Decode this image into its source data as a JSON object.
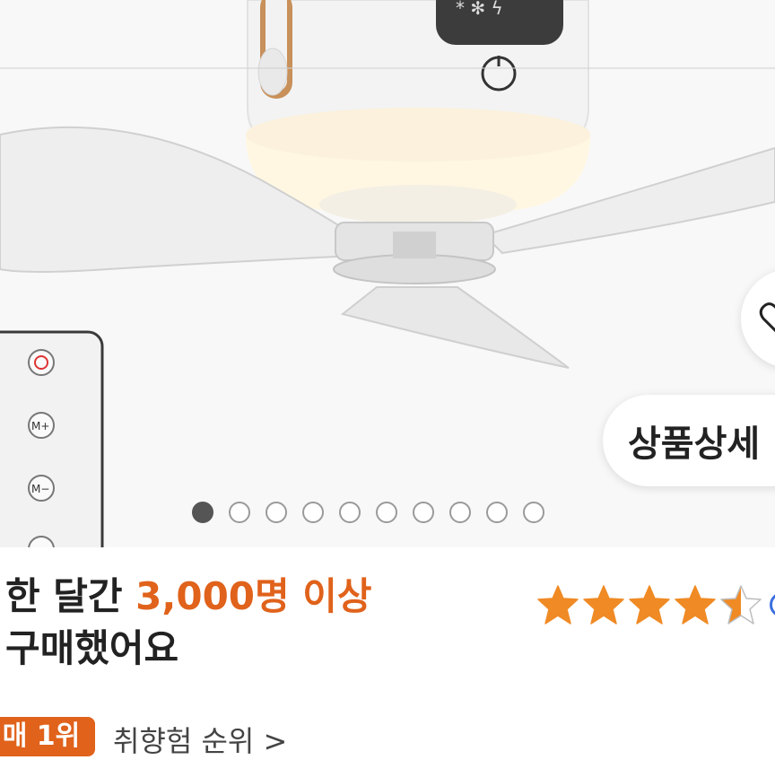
{
  "hero": {
    "detail_button_label": "상품상세",
    "gallery": {
      "total": 10,
      "active": 0
    }
  },
  "summary": {
    "headline_prefix": "한 달간 ",
    "headline_accent": "3,000명 이상",
    "headline_line2": "구매했어요",
    "rating": 4.5,
    "rating_max": 5,
    "star_color": "#f08a24",
    "accent_color": "#e0621b"
  },
  "bottom": {
    "badge_label": "매 1위",
    "link_label": "취향험 순위 >"
  }
}
